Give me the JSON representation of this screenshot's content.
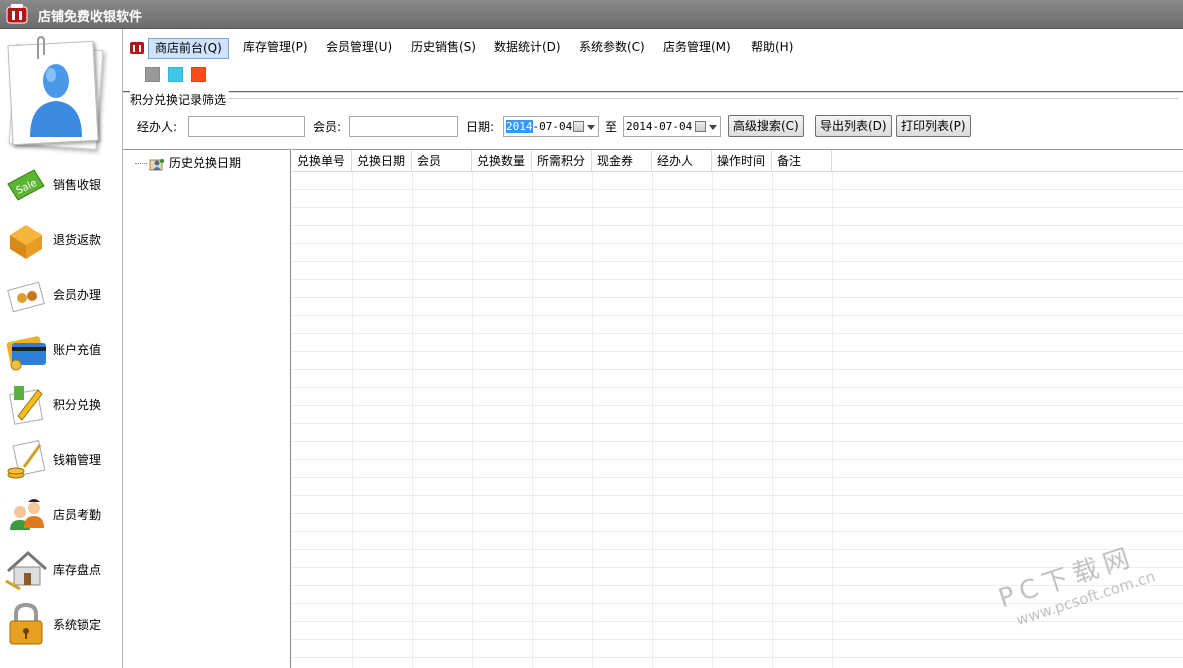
{
  "window": {
    "title": "店铺免费收银软件"
  },
  "sidebar": {
    "items": [
      {
        "label": "销售收银",
        "icon": "sale-tag-icon"
      },
      {
        "label": "退货返款",
        "icon": "return-box-icon"
      },
      {
        "label": "会员办理",
        "icon": "member-card-icon"
      },
      {
        "label": "账户充值",
        "icon": "credit-card-icon"
      },
      {
        "label": "积分兑换",
        "icon": "points-exchange-icon"
      },
      {
        "label": "钱箱管理",
        "icon": "cash-box-icon"
      },
      {
        "label": "店员考勤",
        "icon": "staff-attendance-icon"
      },
      {
        "label": "库存盘点",
        "icon": "inventory-house-icon"
      },
      {
        "label": "系统锁定",
        "icon": "lock-icon"
      }
    ]
  },
  "menu": {
    "items": [
      {
        "label": "商店前台(Q)",
        "active": true
      },
      {
        "label": "库存管理(P)"
      },
      {
        "label": "会员管理(U)"
      },
      {
        "label": "历史销售(S)"
      },
      {
        "label": "数据统计(D)"
      },
      {
        "label": "系统参数(C)"
      },
      {
        "label": "店务管理(M)"
      },
      {
        "label": "帮助(H)"
      }
    ]
  },
  "theme_swatches": [
    "#999999",
    "#3cc8e8",
    "#ff4a1c"
  ],
  "filter": {
    "group_title": "积分兑换记录筛选",
    "operator_label": "经办人:",
    "operator_value": "",
    "member_label": "会员:",
    "member_value": "",
    "date_label": "日期:",
    "date_from_year": "2014",
    "date_from_rest": "-07-04",
    "to_label": "至",
    "date_to": "2014-07-04",
    "advanced_search": "高级搜索(C)",
    "export_list": "导出列表(D)",
    "print_list": "打印列表(P)"
  },
  "tree": {
    "root_label": "历史兑换日期"
  },
  "grid": {
    "columns": [
      "兑换单号",
      "兑换日期",
      "会员",
      "兑换数量",
      "所需积分",
      "现金券",
      "经办人",
      "操作时间",
      "备注"
    ],
    "rows": []
  },
  "watermark": {
    "line1": "PC下载网",
    "line2": "www.pcsoft.com.cn"
  }
}
